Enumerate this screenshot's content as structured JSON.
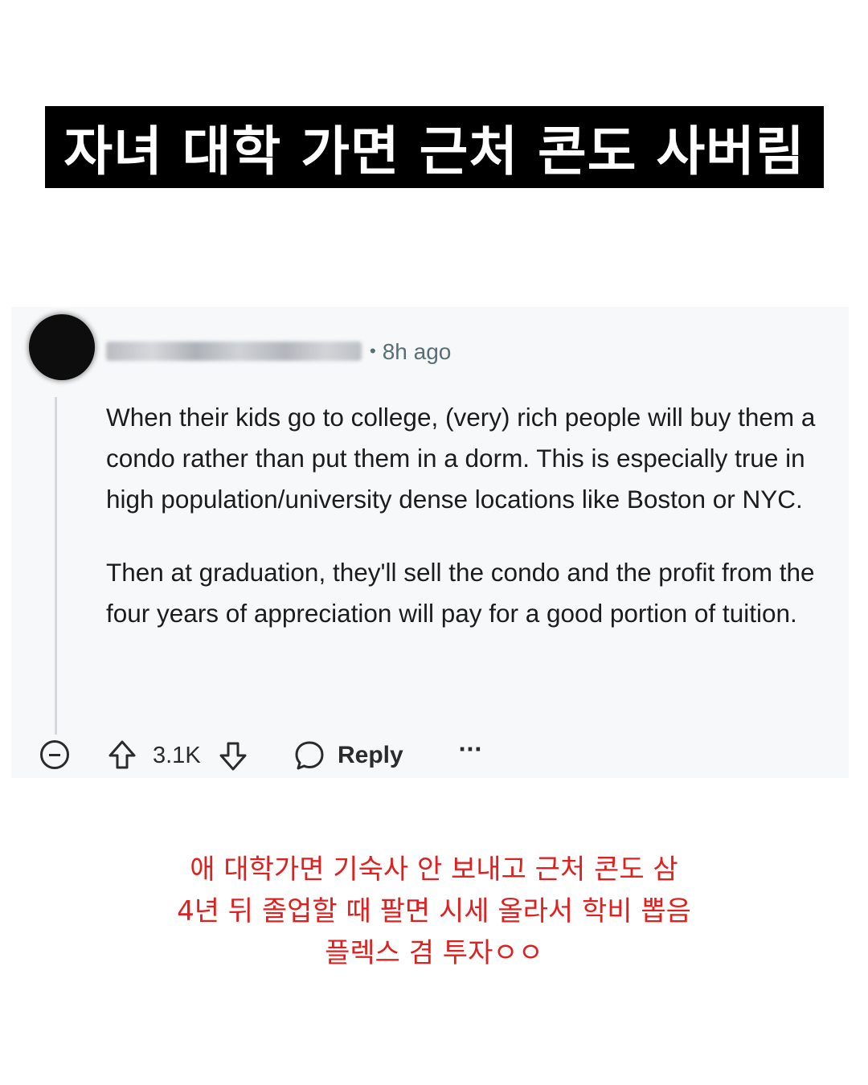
{
  "title": "자녀 대학 가면 근처 콘도 사버림",
  "comment": {
    "timestamp": "8h ago",
    "paragraphs": [
      "When their kids go to college, (very) rich people will buy them a condo rather than put them in a dorm. This is especially true in high population/university dense locations like Boston or NYC.",
      "Then at graduation, they'll sell the condo and the profit from the four years of appreciation will pay for a good portion of tuition."
    ],
    "score": "3.1K",
    "reply_label": "Reply",
    "more_label": "···"
  },
  "caption": {
    "lines": [
      "애 대학가면 기숙사 안 보내고 근처 콘도 삼",
      "4년 뒤 졸업할 때 팔면 시세 올라서 학비 뽑음",
      "플렉스 겸 투자ㅇㅇ"
    ]
  },
  "colors": {
    "title_bg": "#000000",
    "title_text": "#ffffff",
    "card_bg": "#f7f8f9",
    "caption_text": "#e0201f",
    "meta_text": "#576f76"
  },
  "icons": [
    "avatar",
    "collapse-icon",
    "upvote-icon",
    "downvote-icon",
    "reply-bubble-icon",
    "more-options-icon"
  ]
}
